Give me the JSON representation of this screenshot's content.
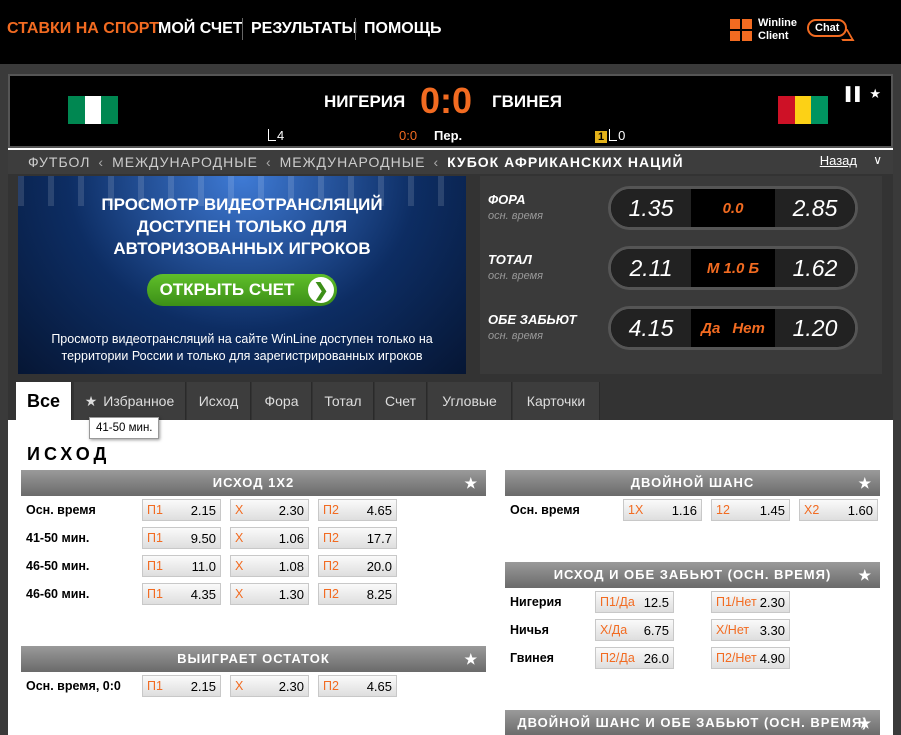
{
  "topnav": {
    "items": [
      "СТАВКИ НА СПОРТ",
      "МОЙ СЧЕТ",
      "РЕЗУЛЬТАТЫ",
      "ПОМОЩЬ"
    ],
    "client_label_1": "Winline",
    "client_label_2": "Client",
    "chat_label": "Chat",
    "accent": "#f26b21"
  },
  "scoreboard": {
    "home": "НИГЕРИЯ",
    "away": "ГВИНЕЯ",
    "score": "0:0",
    "home_corners": "4",
    "period_score": "0:0",
    "period": "Пер.",
    "away_yellow": "1",
    "away_corners": "0",
    "home_flag": [
      "#008751",
      "#ffffff",
      "#008751"
    ],
    "away_flag": [
      "#ce1126",
      "#fcd116",
      "#009460"
    ]
  },
  "breadcrumb": {
    "items": [
      "ФУТБОЛ",
      "МЕЖДУНАРОДНЫЕ",
      "МЕЖДУНАРОДНЫЕ",
      "КУБОК АФРИКАНСКИХ НАЦИЙ"
    ],
    "back": "Назад"
  },
  "stream": {
    "title_1": "ПРОСМОТР ВИДЕОТРАНСЛЯЦИЙ",
    "title_2": "ДОСТУПЕН ТОЛЬКО ДЛЯ",
    "title_3": "АВТОРИЗОВАННЫХ ИГРОКОВ",
    "button": "ОТКРЫТЬ СЧЕТ",
    "note": "Просмотр видеотрансляций на сайте WinLine доступен только на территории России и только для зарегистрированных игроков"
  },
  "quickbets": [
    {
      "label": "ФОРА",
      "sub": "осн. время",
      "left": "1.35",
      "mid": [
        "0.0"
      ],
      "right": "2.85"
    },
    {
      "label": "ТОТАЛ",
      "sub": "осн. время",
      "left": "2.11",
      "mid": [
        "М 1.0 Б"
      ],
      "right": "1.62"
    },
    {
      "label": "ОБЕ ЗАБЬЮТ",
      "sub": "осн. время",
      "left": "4.15",
      "mid": [
        "Да",
        "Нет"
      ],
      "right": "1.20"
    }
  ],
  "tabs": [
    "Все",
    "Избранное",
    "Исход",
    "Фора",
    "Тотал",
    "Счет",
    "Угловые",
    "Карточки"
  ],
  "section_title": "ИСХОД",
  "tooltip": "41-50 мин.",
  "markets": {
    "m1x2": {
      "title": "ИСХОД 1Х2",
      "rows": [
        {
          "label": "Осн. время",
          "odds": [
            [
              "П1",
              "2.15"
            ],
            [
              "Х",
              "2.30"
            ],
            [
              "П2",
              "4.65"
            ]
          ]
        },
        {
          "label": "41-50 мин.",
          "odds": [
            [
              "П1",
              "9.50"
            ],
            [
              "Х",
              "1.06"
            ],
            [
              "П2",
              "17.7"
            ]
          ]
        },
        {
          "label": "46-50 мин.",
          "odds": [
            [
              "П1",
              "11.0"
            ],
            [
              "Х",
              "1.08"
            ],
            [
              "П2",
              "20.0"
            ]
          ]
        },
        {
          "label": "46-60 мин.",
          "odds": [
            [
              "П1",
              "4.35"
            ],
            [
              "Х",
              "1.30"
            ],
            [
              "П2",
              "8.25"
            ]
          ]
        }
      ]
    },
    "remainder": {
      "title": "ВЫИГРАЕТ ОСТАТОК",
      "rows": [
        {
          "label": "Осн. время, 0:0",
          "odds": [
            [
              "П1",
              "2.15"
            ],
            [
              "Х",
              "2.30"
            ],
            [
              "П2",
              "4.65"
            ]
          ]
        }
      ]
    },
    "double": {
      "title": "ДВОЙНОЙ ШАНС",
      "rows": [
        {
          "label": "Осн. время",
          "odds": [
            [
              "1Х",
              "1.16"
            ],
            [
              "12",
              "1.45"
            ],
            [
              "Х2",
              "1.60"
            ]
          ]
        }
      ]
    },
    "btts": {
      "title": "ИСХОД И ОБЕ ЗАБЬЮТ (ОСН. ВРЕМЯ)",
      "rows": [
        {
          "label": "Нигерия",
          "odds": [
            [
              "П1/Да",
              "12.5"
            ],
            [
              "П1/Нет",
              "2.30"
            ]
          ]
        },
        {
          "label": "Ничья",
          "odds": [
            [
              "Х/Да",
              "6.75"
            ],
            [
              "Х/Нет",
              "3.30"
            ]
          ]
        },
        {
          "label": "Гвинея",
          "odds": [
            [
              "П2/Да",
              "26.0"
            ],
            [
              "П2/Нет",
              "4.90"
            ]
          ]
        }
      ]
    },
    "double_btts": {
      "title": "ДВОЙНОЙ ШАНС И ОБЕ ЗАБЬЮТ (ОСН. ВРЕМЯ)"
    }
  }
}
